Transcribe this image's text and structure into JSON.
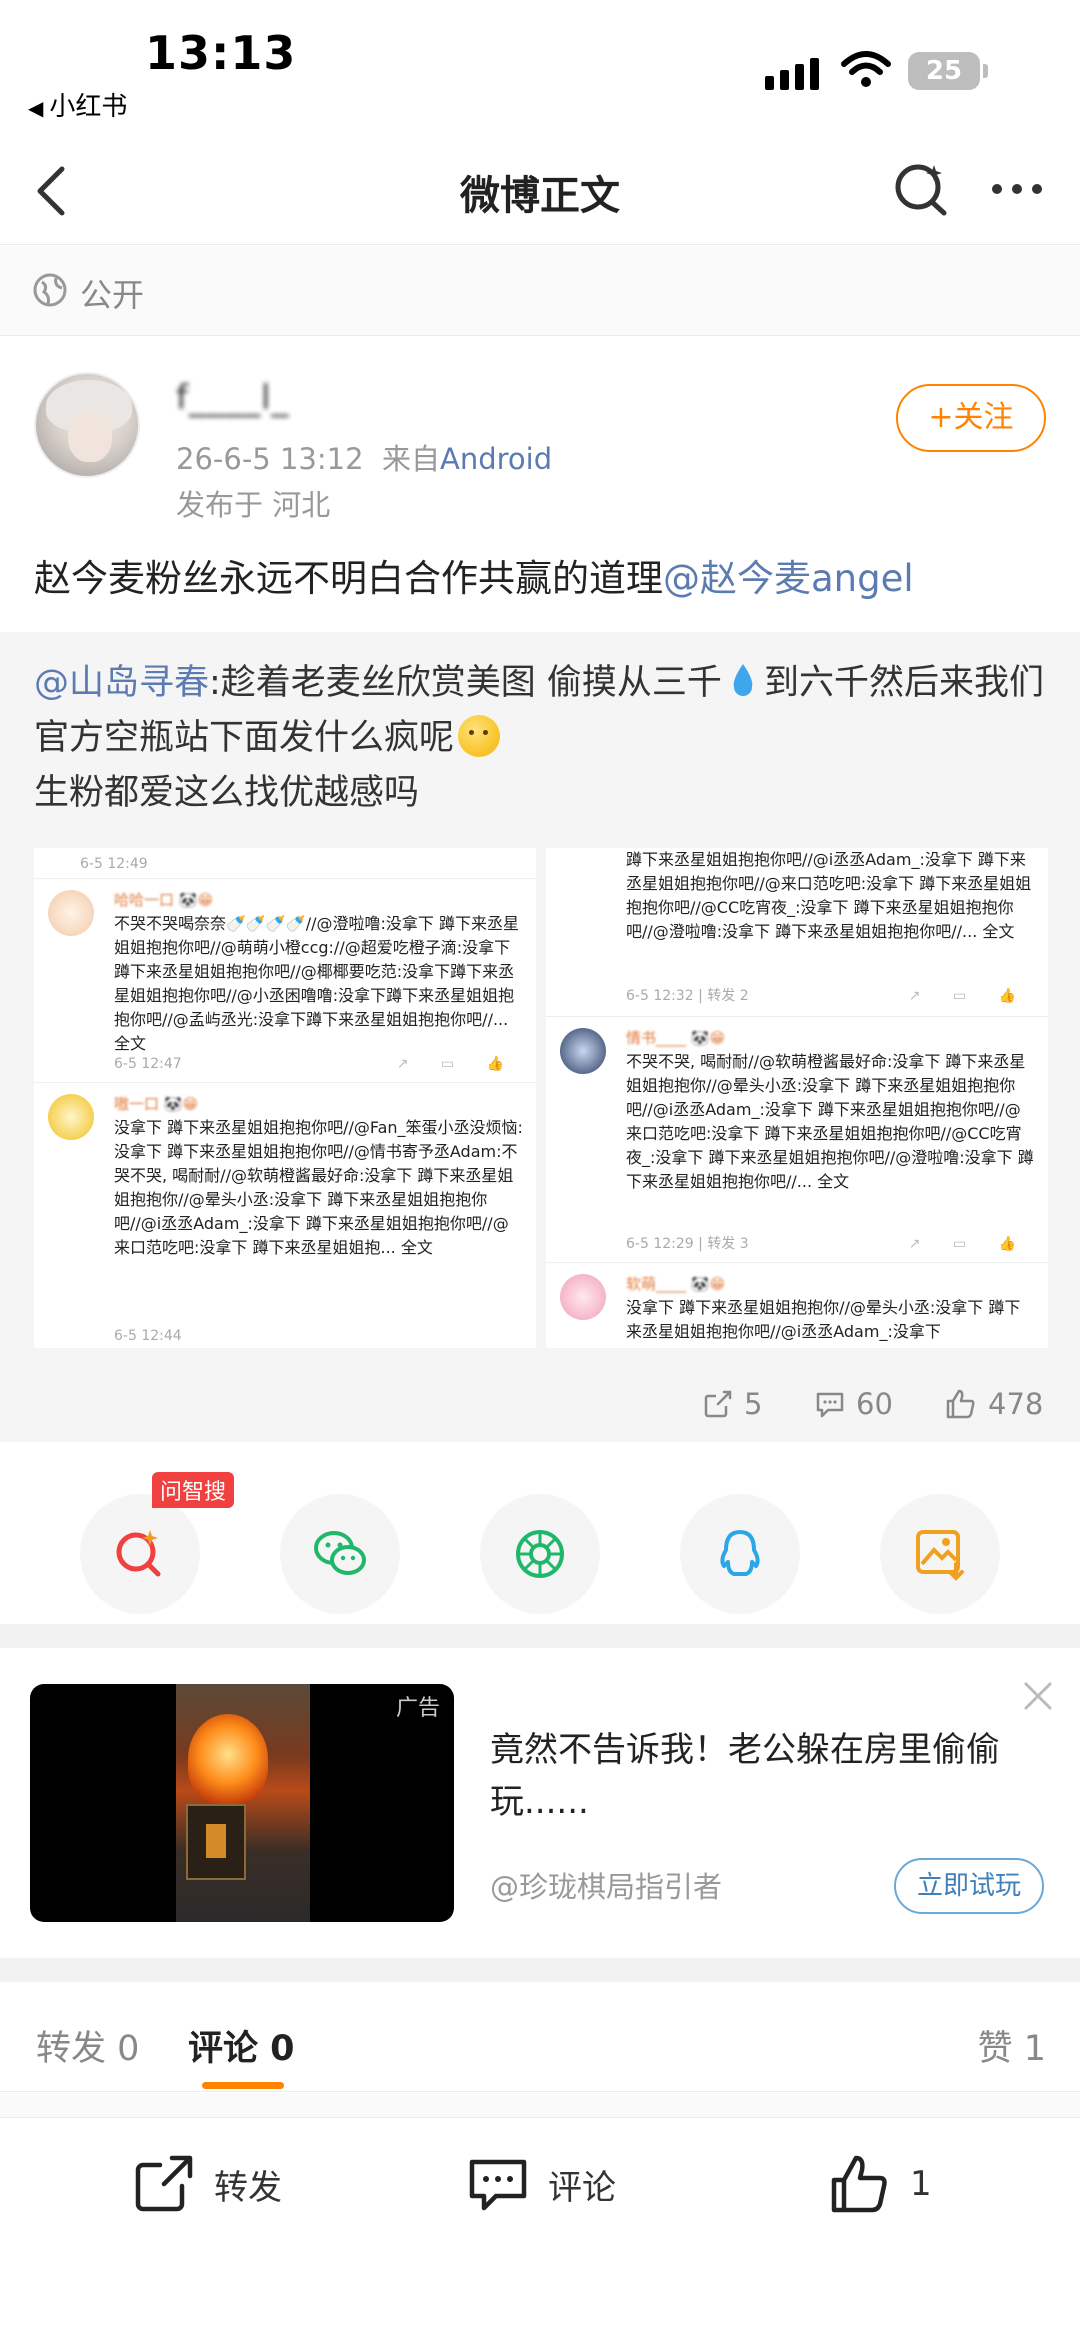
{
  "status_bar": {
    "time": "13:13",
    "back_app": "小红书",
    "battery": "25"
  },
  "nav": {
    "title": "微博正文"
  },
  "visibility": {
    "label": "公开"
  },
  "post": {
    "username": "f____l_",
    "time": "26-6-5 13:12",
    "from_label": "来自",
    "source": "Android",
    "region": "发布于 河北",
    "follow_label": "+关注",
    "text": "赵今麦粉丝永远不明白合作共赢的道理",
    "mention": "@赵今麦angel"
  },
  "repost": {
    "mention": "@山岛寻春",
    "text_a": ":趁着老麦丝欣赏美图 偷摸从三千",
    "text_b": "到六千然后来我们官方空瓶站下面发什么疯呢",
    "text_c": "生粉都爱这么找优越感吗",
    "stats": {
      "reposts": "5",
      "comments": "60",
      "likes": "478"
    },
    "screenshot_left": {
      "time_top": "6-5 12:49",
      "c1_name": "哈哈一口 🐼😁",
      "c1_body": "不哭不哭喝奈奈🍼🍼🍼🍼//@澄啦噜:没拿下 蹲下来丞星姐姐抱抱你吧//@萌萌小橙ccg://@超爱吃橙子滴:没拿下 蹲下来丞星姐姐抱抱你吧//@椰椰要吃范:没拿下蹲下来丞星姐姐抱抱你吧//@小丞困噜噜:没拿下蹲下来丞星姐姐抱抱你吧//@孟屿丞光:没拿下蹲下来丞星姐姐抱抱你吧//... 全文",
      "c1_time": "6-5 12:47",
      "c2_name": "嗷一口 🐼😁",
      "c2_body": "没拿下 蹲下来丞星姐姐抱抱你吧//@Fan_笨蛋小丞没烦恼:没拿下 蹲下来丞星姐姐抱抱你吧//@情书寄予丞Adam:不哭不哭, 喝耐耐//@软萌橙酱最好命:没拿下 蹲下来丞星姐姐抱抱你//@晕头小丞:没拿下 蹲下来丞星姐姐抱抱你吧//@i丞丞Adam_:没拿下 蹲下来丞星姐姐抱抱你吧//@来口范吃吧:没拿下 蹲下来丞星姐姐抱... 全文",
      "c2_time": "6-5 12:44"
    },
    "screenshot_right": {
      "c0_body": "蹲下来丞星姐姐抱抱你吧//@i丞丞Adam_:没拿下 蹲下来丞星姐姐抱抱你吧//@来口范吃吧:没拿下 蹲下来丞星姐姐抱抱你吧//@CC吃宵夜_:没拿下 蹲下来丞星姐姐抱抱你吧//@澄啦噜:没拿下 蹲下来丞星姐姐抱抱你吧//... 全文",
      "c0_time": "6-5 12:32 | 转发 2",
      "c1_name": "情书____ 🐼😁",
      "c1_body": "不哭不哭, 喝耐耐//@软萌橙酱最好命:没拿下 蹲下来丞星姐姐抱抱你//@晕头小丞:没拿下 蹲下来丞星姐姐抱抱你吧//@i丞丞Adam_:没拿下 蹲下来丞星姐姐抱抱你吧//@来口范吃吧:没拿下 蹲下来丞星姐姐抱抱你吧//@CC吃宵夜_:没拿下 蹲下来丞星姐姐抱抱你吧//@澄啦噜:没拿下 蹲下来丞星姐姐抱抱你吧//... 全文",
      "c1_time": "6-5 12:29 | 转发 3",
      "c2_name": "软萌____ 🐼😁",
      "c2_body": "没拿下 蹲下来丞星姐姐抱抱你//@晕头小丞:没拿下 蹲下来丞星姐姐抱抱你吧//@i丞丞Adam_:没拿下"
    }
  },
  "share": {
    "ai_badge": "问智搜"
  },
  "ad": {
    "tag": "广告",
    "title": "竟然不告诉我！老公躲在房里偷偷玩......",
    "source": "@珍珑棋局指引者",
    "button": "立即试玩"
  },
  "tabs": {
    "repost": "转发 0",
    "comment": "评论 0",
    "like": "赞 1"
  },
  "bottom": {
    "repost": "转发",
    "comment": "评论",
    "like_count": "1"
  },
  "colors": {
    "accent": "#ff8200",
    "link": "#5c7bb0",
    "badge_red": "#f04040"
  }
}
